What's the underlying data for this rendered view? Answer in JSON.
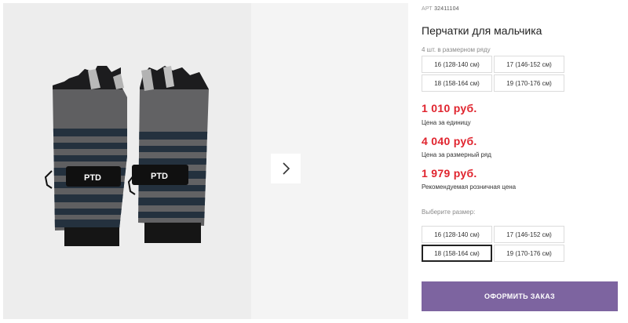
{
  "gallery": {
    "image_alt": "gloves-photo",
    "brand_label_left": "PTD",
    "brand_label_right": "PTD",
    "next_icon": "chevron-right-icon"
  },
  "product": {
    "art_prefix": "АРТ",
    "art_number": "32411104",
    "title": "Перчатки для мальчика",
    "pack_label": "4 шт. в размерном ряду",
    "pack_sizes": [
      "16 (128-140 см)",
      "17 (146-152 см)",
      "18 (158-164 см)",
      "19 (170-176 см)"
    ],
    "prices": [
      {
        "value": "1 010 руб.",
        "caption": "Цена за единицу"
      },
      {
        "value": "4 040 руб.",
        "caption": "Цена за размерный ряд"
      },
      {
        "value": "1 979 руб.",
        "caption": "Рекомендуемая розничная цена"
      }
    ],
    "choose_label": "Выберите размер:",
    "sizes": [
      "16 (128-140 см)",
      "17 (146-152 см)",
      "18 (158-164 см)",
      "19 (170-176 см)"
    ],
    "selected_size": "18 (158-164 см)",
    "order_button": "ОФОРМИТЬ ЗАКАЗ"
  },
  "colors": {
    "price": "#e0242e",
    "button": "#7d64a0"
  }
}
